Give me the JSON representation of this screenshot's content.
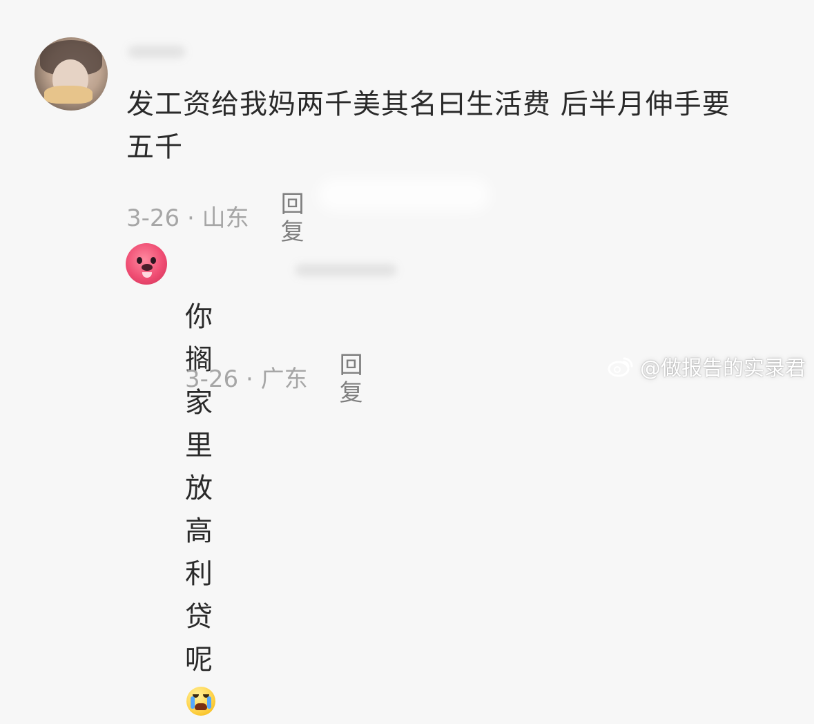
{
  "comments": [
    {
      "text_line_1": "发工资给我妈两千美其名曰生活费 后半月伸手要",
      "text_line_2": "五千",
      "date_region": "3-26 · 山东",
      "reply_label": "回复"
    },
    {
      "text": "你搁家里放高利贷呢",
      "emoji_icon": "crying-face-icon",
      "date_region": "3-26 · 广东",
      "reply_label": "回复"
    }
  ],
  "watermark": {
    "text": "@做报告的实录君",
    "icon": "weibo-icon"
  }
}
